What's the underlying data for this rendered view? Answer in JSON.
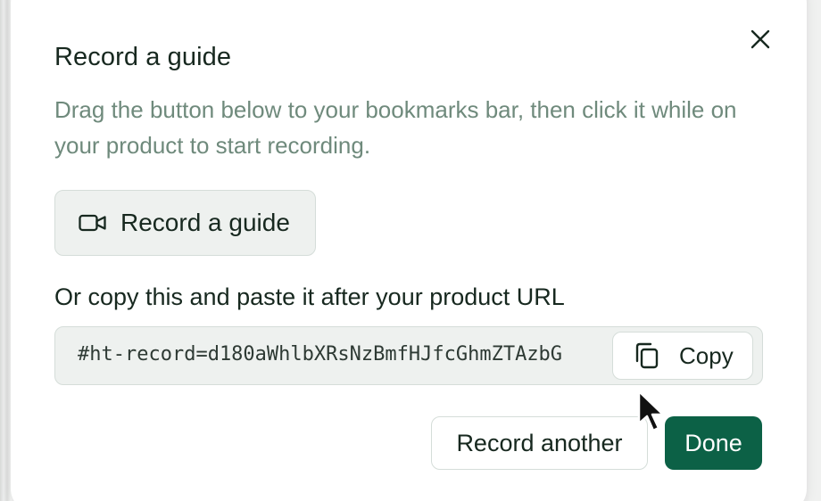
{
  "dialog": {
    "title": "Record a guide",
    "subtitle": "Drag the button below to your bookmarks bar, then click it while on your product to start recording.",
    "close_icon": "close-icon"
  },
  "record_button": {
    "label": "Record a guide",
    "icon": "video-camera-icon"
  },
  "copy_section": {
    "heading": "Or copy this and paste it after your product URL",
    "code": "#ht-record=d180aWhlbXRsNzBmfHJfcGhmZTAzbG",
    "copy_label": "Copy",
    "copy_icon": "copy-icon"
  },
  "actions": {
    "record_another_label": "Record another",
    "done_label": "Done"
  },
  "colors": {
    "primary": "#0c6146",
    "text": "#17281f",
    "muted": "#6f8a7c",
    "surface": "#eef1ef"
  }
}
